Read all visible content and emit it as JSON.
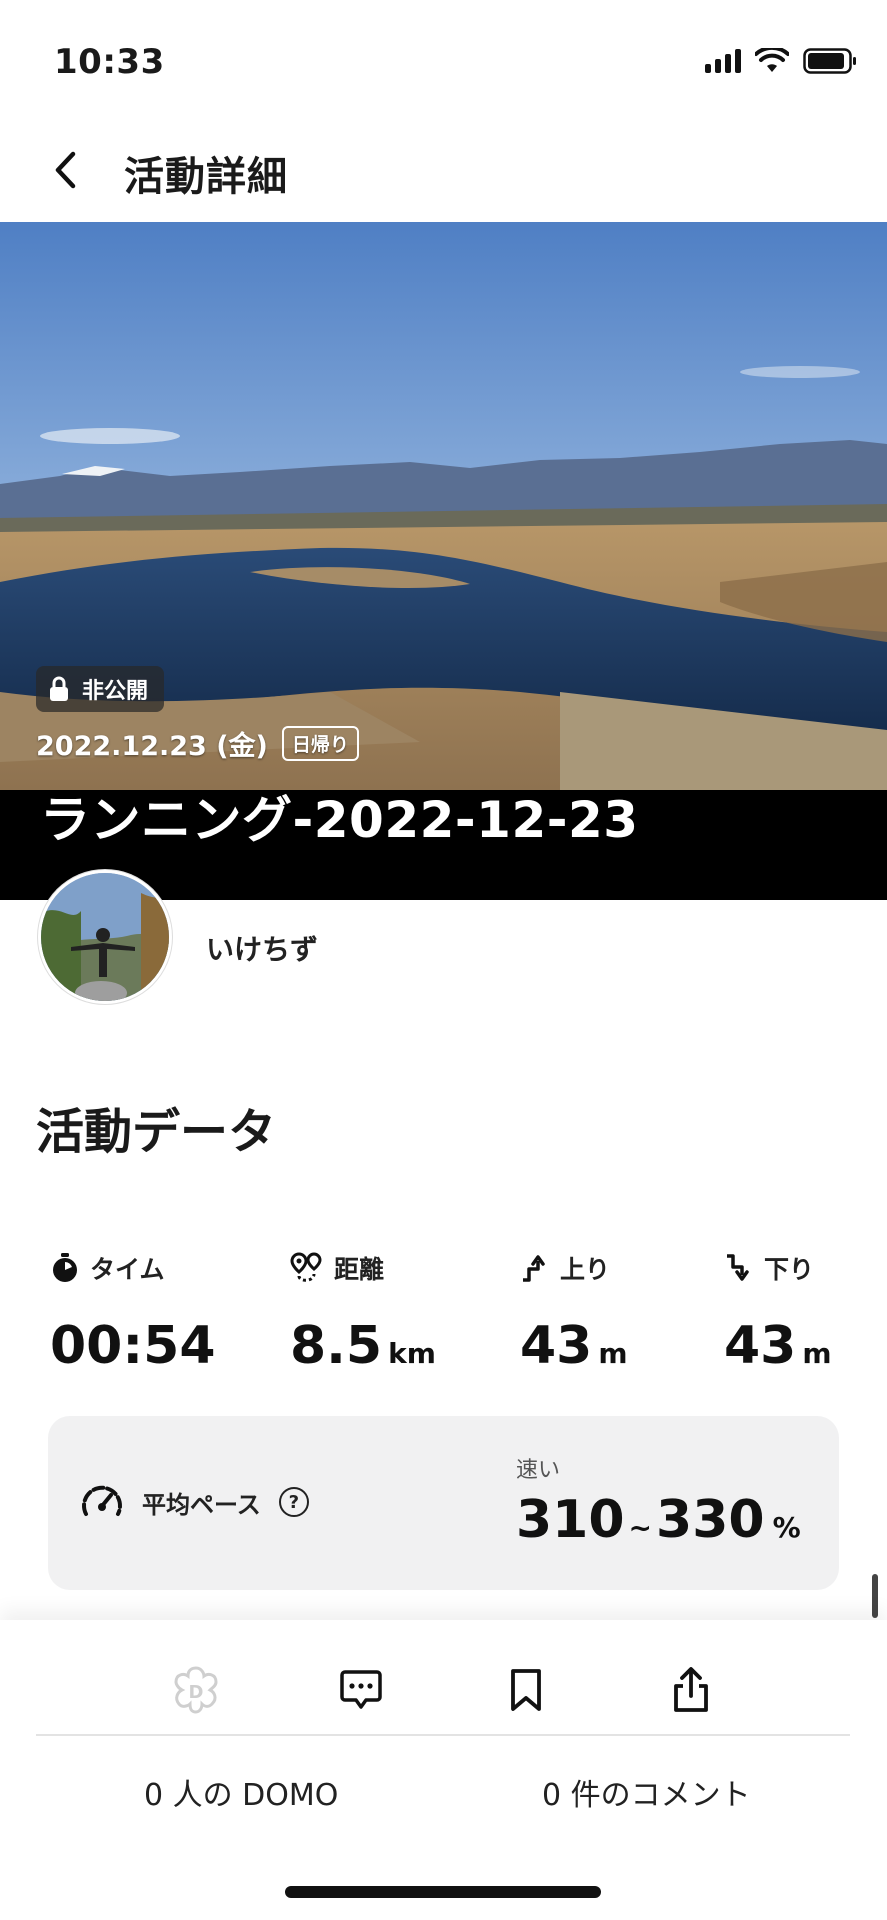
{
  "status_bar": {
    "time": "10:33"
  },
  "header": {
    "title": "活動詳細"
  },
  "hero": {
    "privacy": "非公開",
    "date": "2022.12.23 (金)",
    "trip_type": "日帰り",
    "title": "ランニング-2022-12-23"
  },
  "user": {
    "name": "いけちず"
  },
  "activity": {
    "section_title": "活動データ",
    "stats": [
      {
        "label": "タイム",
        "value": "00:54",
        "unit": ""
      },
      {
        "label": "距離",
        "value": "8.5",
        "unit": "km"
      },
      {
        "label": "上り",
        "value": "43",
        "unit": "m"
      },
      {
        "label": "下り",
        "value": "43",
        "unit": "m"
      }
    ],
    "pace": {
      "label": "平均ペース",
      "help": "?",
      "speed": "速い",
      "min": "310",
      "tilde": "~",
      "max": "330",
      "unit": "%"
    }
  },
  "actions": {
    "domo_count": "0 人の DOMO",
    "comment_count": "0 件のコメント"
  },
  "colors": {
    "accent": "#111111",
    "card_bg": "#f1f1f2",
    "domo_inactive": "#cfcfcf"
  }
}
